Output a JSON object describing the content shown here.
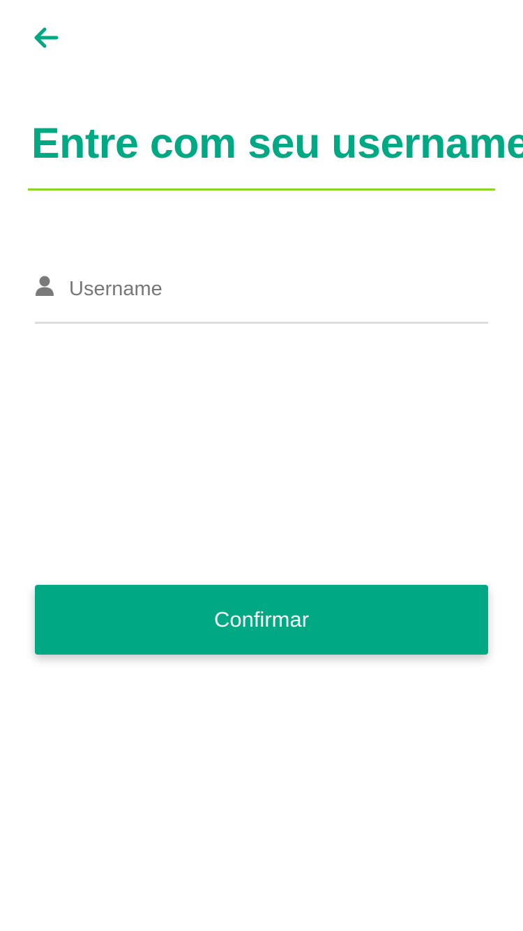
{
  "header": {
    "back_icon": "arrow-left-icon"
  },
  "page": {
    "title": "Entre com seu username"
  },
  "form": {
    "username": {
      "icon": "user-icon",
      "placeholder": "Username",
      "value": ""
    }
  },
  "actions": {
    "confirm_label": "Confirmar"
  },
  "theme": {
    "primary": "#00a884",
    "accent_line": "#8fd422",
    "field_line": "#dcdcdc",
    "placeholder": "#777777",
    "background": "#ffffff"
  }
}
